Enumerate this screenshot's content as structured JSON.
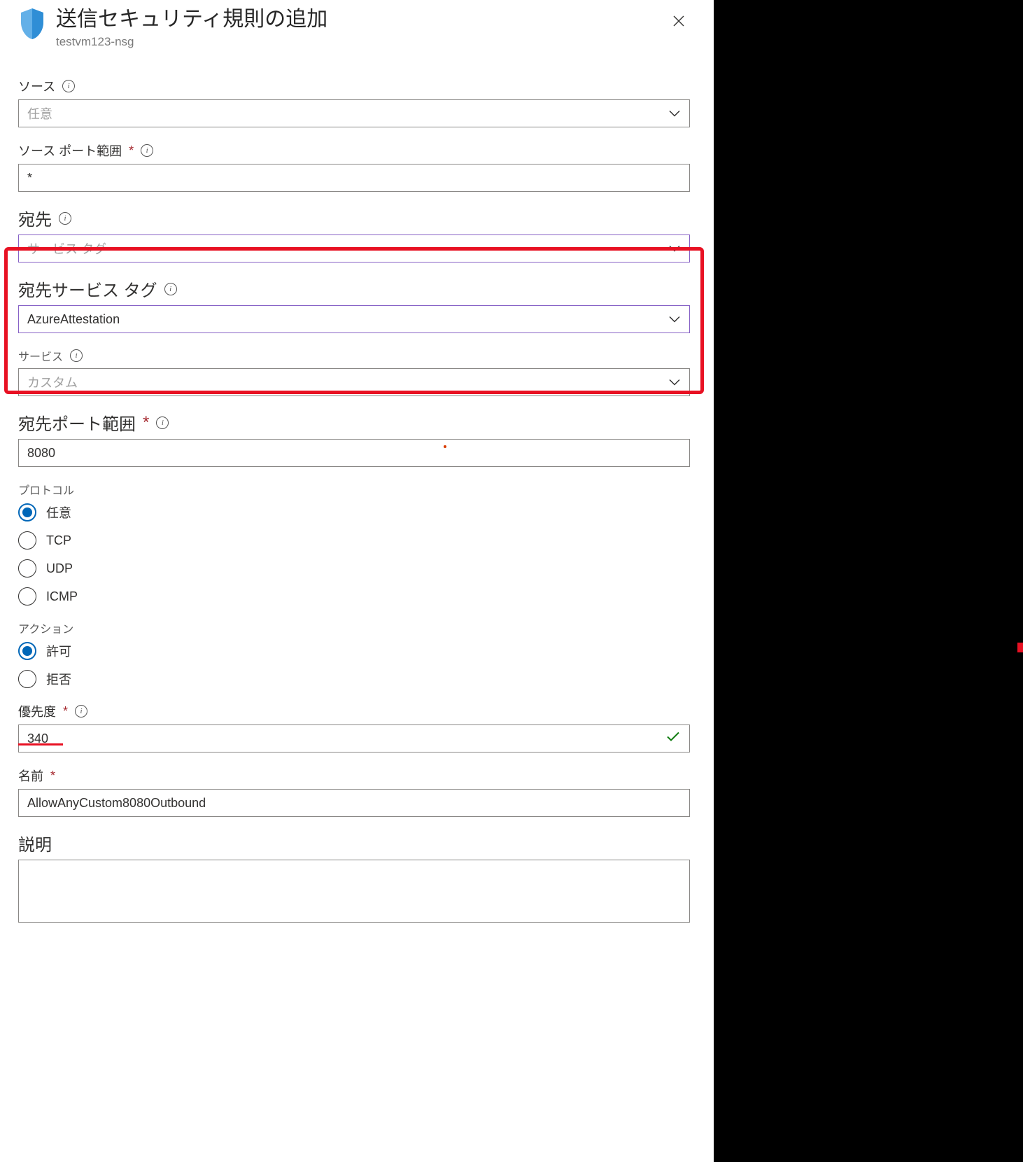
{
  "header": {
    "title": "送信セキュリティ規則の追加",
    "subtitle": "testvm123-nsg"
  },
  "fields": {
    "source": {
      "label": "ソース",
      "value": "任意"
    },
    "sourcePortRange": {
      "label": "ソース ポート範囲",
      "value": "*"
    },
    "destination": {
      "label": "宛先",
      "value": "サービス タグ"
    },
    "destServiceTag": {
      "label": "宛先サービス タグ",
      "value": "AzureAttestation"
    },
    "service": {
      "label": "サービス",
      "value": "カスタム"
    },
    "destPortRange": {
      "label": "宛先ポート範囲",
      "value": "8080"
    },
    "protocol": {
      "label": "プロトコル",
      "options": [
        "任意",
        "TCP",
        "UDP",
        "ICMP"
      ],
      "selected": "任意"
    },
    "action": {
      "label": "アクション",
      "options": [
        "許可",
        "拒否"
      ],
      "selected": "許可"
    },
    "priority": {
      "label": "優先度",
      "value": "340"
    },
    "name": {
      "label": "名前",
      "value": "AllowAnyCustom8080Outbound"
    },
    "description": {
      "label": "説明",
      "value": ""
    }
  }
}
